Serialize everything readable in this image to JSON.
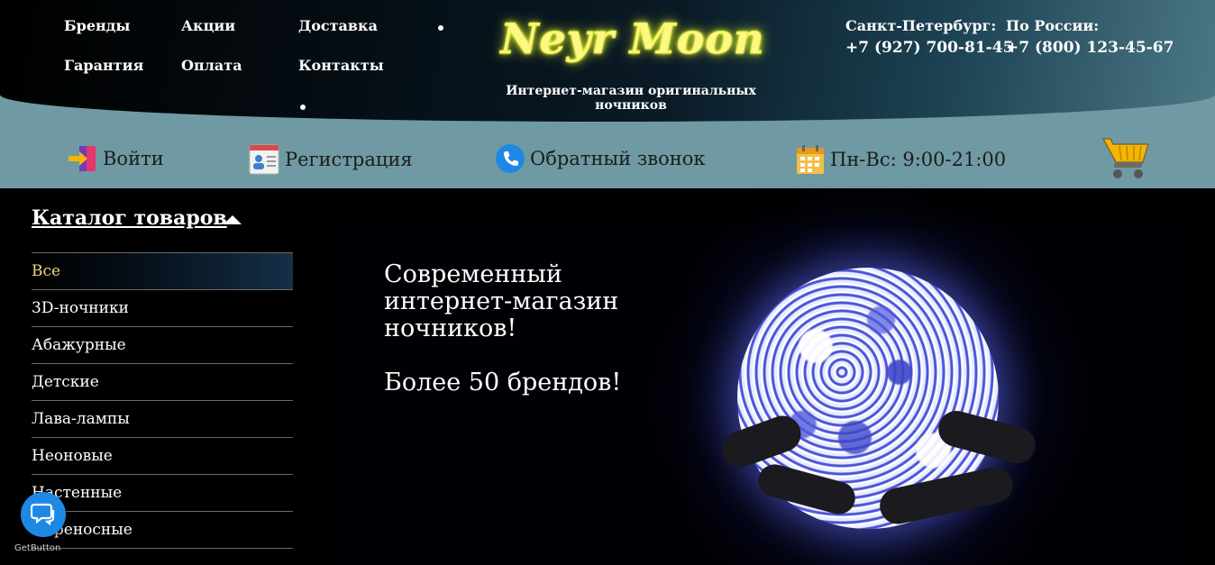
{
  "nav": {
    "brands": "Бренды",
    "promos": "Акции",
    "delivery": "Доставка",
    "warranty": "Гарантия",
    "payment": "Оплата",
    "contacts": "Контакты"
  },
  "logo": {
    "name": "Neyr Moon",
    "tagline": "Интернет-магазин оригинальных ночников"
  },
  "phones": {
    "spb_label": "Санкт-Петербург:",
    "spb_number": "+7 (927) 700-81-45",
    "russia_label": "По России:",
    "russia_number": "+7 (800) 123-45-67"
  },
  "actions": {
    "login": "Войти",
    "register": "Регистрация",
    "callback": "Обратный звонок",
    "hours": "Пн-Вс: 9:00-21:00"
  },
  "catalog": {
    "title": "Каталог товаров",
    "items": [
      "Все",
      "3D-ночники",
      "Абажурные",
      "Детские",
      "Лава-лампы",
      "Неоновые",
      "Настенные",
      "Переносные"
    ]
  },
  "banner": {
    "line1": "Современный интернет-магазин ночников!",
    "line2": "Более 50 брендов!"
  },
  "widget": {
    "brand": "GetButton"
  },
  "colors": {
    "header_band": "#6f9aa3",
    "logo_glow": "#eaff3a",
    "active_item": "#f7d77a",
    "chat_button": "#1e88e5"
  }
}
